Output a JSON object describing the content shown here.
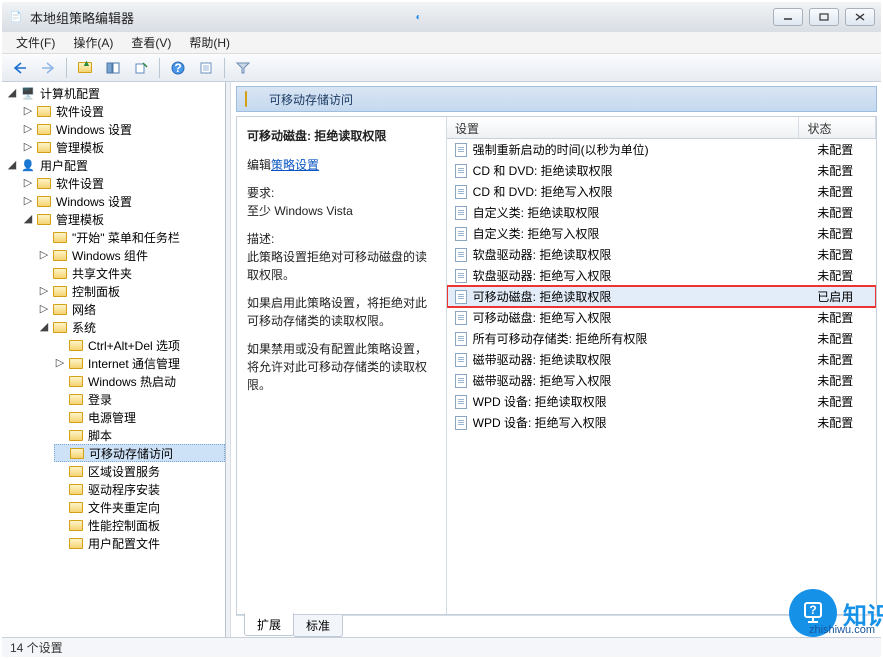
{
  "window": {
    "title": "本地组策略编辑器"
  },
  "menus": {
    "file": "文件(F)",
    "action": "操作(A)",
    "view": "查看(V)",
    "help": "帮助(H)"
  },
  "tree": {
    "root1": "计算机配置",
    "r1a": "软件设置",
    "r1b": "Windows 设置",
    "r1c": "管理模板",
    "root2": "用户配置",
    "r2a": "软件设置",
    "r2b": "Windows 设置",
    "r2c": "管理模板",
    "start": "\"开始\" 菜单和任务栏",
    "wincomp": "Windows 组件",
    "shared": "共享文件夹",
    "cpl": "控制面板",
    "net": "网络",
    "sys": "系统",
    "cad": "Ctrl+Alt+Del 选项",
    "icomm": "Internet 通信管理",
    "hotboot": "Windows 热启动",
    "login": "登录",
    "power": "电源管理",
    "script": "脚本",
    "removable": "可移动存储访问",
    "locale": "区域设置服务",
    "drv": "驱动程序安装",
    "folderR": "文件夹重定向",
    "perf": "性能控制面板",
    "usercfg": "用户配置文件"
  },
  "header": {
    "title": "可移动存储访问"
  },
  "desc": {
    "title": "可移动磁盘: 拒绝读取权限",
    "edit_prefix": "编辑",
    "edit_link": "策略设置",
    "req_label": "要求:",
    "req_value": "至少 Windows Vista",
    "desc_label": "描述:",
    "d1": "此策略设置拒绝对可移动磁盘的读取权限。",
    "d2": "如果启用此策略设置，将拒绝对此可移动存储类的读取权限。",
    "d3": "如果禁用或没有配置此策略设置，将允许对此可移动存储类的读取权限。"
  },
  "columns": {
    "setting": "设置",
    "state": "状态"
  },
  "list": [
    {
      "name": "强制重新启动的时间(以秒为单位)",
      "state": "未配置"
    },
    {
      "name": "CD 和 DVD: 拒绝读取权限",
      "state": "未配置"
    },
    {
      "name": "CD 和 DVD: 拒绝写入权限",
      "state": "未配置"
    },
    {
      "name": "自定义类: 拒绝读取权限",
      "state": "未配置"
    },
    {
      "name": "自定义类: 拒绝写入权限",
      "state": "未配置"
    },
    {
      "name": "软盘驱动器: 拒绝读取权限",
      "state": "未配置"
    },
    {
      "name": "软盘驱动器: 拒绝写入权限",
      "state": "未配置"
    },
    {
      "name": "可移动磁盘: 拒绝读取权限",
      "state": "已启用",
      "hl": true
    },
    {
      "name": "可移动磁盘: 拒绝写入权限",
      "state": "未配置"
    },
    {
      "name": "所有可移动存储类: 拒绝所有权限",
      "state": "未配置"
    },
    {
      "name": "磁带驱动器: 拒绝读取权限",
      "state": "未配置"
    },
    {
      "name": "磁带驱动器: 拒绝写入权限",
      "state": "未配置"
    },
    {
      "name": "WPD 设备: 拒绝读取权限",
      "state": "未配置"
    },
    {
      "name": "WPD 设备: 拒绝写入权限",
      "state": "未配置"
    }
  ],
  "tabs": {
    "extended": "扩展",
    "standard": "标准"
  },
  "status": {
    "text": "14 个设置"
  },
  "watermark": {
    "brand": "知识屋",
    "url": "zhishiwu.com"
  }
}
